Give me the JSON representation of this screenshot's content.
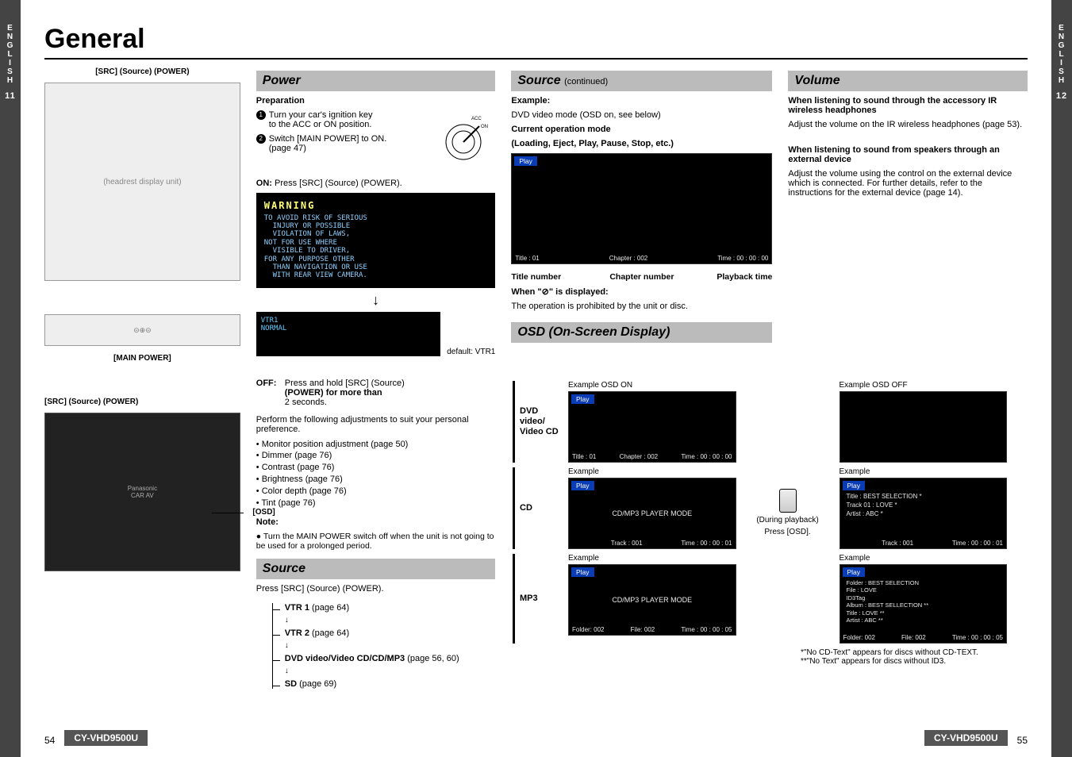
{
  "left_tab": {
    "lang": "E\nN\nG\nL\nI\nS\nH",
    "num": "11"
  },
  "right_tab": {
    "lang": "E\nN\nG\nL\nI\nS\nH",
    "num": "12"
  },
  "title": "General",
  "col1": {
    "src_label": "[SRC] (Source) (POWER)",
    "main_power_label": "[MAIN POWER]",
    "src_label2": "[SRC] (Source) (POWER)",
    "osd_label": "[OSD]",
    "device_placeholder": "(headrest display unit)",
    "remote_placeholder": "Panasonic\nCAR AV"
  },
  "power": {
    "header": "Power",
    "prep_head": "Preparation",
    "step1_a": "Turn your car's ignition key",
    "step1_b": "to the ACC or ON position.",
    "step2_a": "Switch [MAIN POWER] to ON.",
    "step2_b": "(page 47)",
    "on_line_a": "ON:",
    "on_line_b": "Press [SRC] (Source) (POWER).",
    "warn_title": "WARNING",
    "warn_body": "TO AVOID RISK OF SERIOUS\n  INJURY OR POSSIBLE\n  VIOLATION OF LAWS,\nNOT FOR USE WHERE\n  VISIBLE TO DRIVER,\nFOR ANY PURPOSE OTHER\n  THAN NAVIGATION OR USE\n  WITH REAR VIEW CAMERA.",
    "vtr_box": "VTR1\nNORMAL",
    "default_label": "default: VTR1",
    "off_term": "OFF:",
    "off_a": "Press and hold [SRC] (Source)",
    "off_b": "(POWER) for more than",
    "off_c": "2 seconds.",
    "adjust_intro": "Perform the following adjustments to suit your personal preference.",
    "bullets": [
      "Monitor position adjustment (page 50)",
      "Dimmer (page 76)",
      "Contrast (page 76)",
      "Brightness (page 76)",
      "Color depth (page 76)",
      "Tint (page 76)"
    ],
    "note_head": "Note:",
    "note_body": "Turn the MAIN POWER switch off when the unit is not going to be used for a prolonged period."
  },
  "source": {
    "header": "Source",
    "press_line": "Press [SRC] (Source) (POWER).",
    "items": [
      {
        "name": "VTR 1",
        "pg": "(page 64)"
      },
      {
        "name": "VTR 2",
        "pg": "(page 64)"
      },
      {
        "name": "DVD video/Video CD/CD/MP3",
        "pg": "(page 56, 60)"
      },
      {
        "name": "SD",
        "pg": "(page 69)"
      }
    ]
  },
  "source_cont": {
    "header": "Source",
    "header_small": "(continued)",
    "example_head": "Example:",
    "example_line": "DVD video mode (OSD on, see below)",
    "cur_head": "Current operation mode",
    "cur_sub": "(Loading, Eject, Play, Pause, Stop, etc.)",
    "screen_top": "Play",
    "screen_bot_l": "Title : 01",
    "screen_bot_m": "Chapter : 002",
    "screen_bot_r": "Time : 00 : 00 : 00",
    "sub_labels": {
      "a": "Title number",
      "b": "Chapter number",
      "c": "Playback time"
    },
    "when_a": "When \"",
    "when_sym": "⊘",
    "when_b": "\" is displayed:",
    "when_body": "The operation is prohibited by the unit or disc."
  },
  "volume": {
    "header": "Volume",
    "h1": "When listening to sound through the accessory IR wireless headphones",
    "p1": "Adjust the volume on the IR wireless headphones (page 53).",
    "h2": "When listening to sound from speakers through an external device",
    "p2": "Adjust the volume using the control on the external device which is connected. For further details, refer to the instructions for the external device (page 14)."
  },
  "osd": {
    "header": "OSD (On-Screen Display)",
    "labels": {
      "dvd": "DVD video/ Video CD",
      "cd": "CD",
      "mp3": "MP3"
    },
    "middle": {
      "during": "(During playback)",
      "press": "Press [OSD]."
    },
    "on_ex": "Example     OSD ON",
    "off_ex": "Example     OSD OFF",
    "ex_word": "Example",
    "dvd_on": {
      "top": "Play",
      "bl": "Title : 01",
      "bm": "Chapter : 002",
      "br": "Time : 00 : 00 : 00"
    },
    "cd_on": {
      "top": "Play",
      "center": "CD/MP3 PLAYER MODE",
      "bl": "",
      "bm": "Track : 001",
      "br": "Time : 00 : 00 : 01"
    },
    "cd_off": {
      "top": "Play",
      "l1": "Title       : BEST SELECTION *",
      "l2": "Track 01 : LOVE *",
      "l3": "Artist     : ABC *",
      "bm": "Track : 001",
      "br": "Time : 00 : 00 : 01"
    },
    "mp3_on": {
      "top": "Play",
      "center": "CD/MP3 PLAYER MODE",
      "bl": "Folder: 002",
      "bm": "File: 002",
      "br": "Time : 00 : 00 : 05"
    },
    "mp3_off": {
      "top": "Play",
      "l1": "Folder    : BEST SELECTION",
      "l2": "File        : LOVE",
      "l3": "ID3Tag",
      "l4": " Album   : BEST SELLECTION **",
      "l5": " Title      : LOVE **",
      "l6": " Artist     : ABC **",
      "bl": "Folder: 002",
      "bm": "File: 002",
      "br": "Time : 00 : 00 : 05"
    },
    "foot1": "*\"No CD-Text\" appears for discs without CD-TEXT.",
    "foot2": "**\"No Text\" appears for discs without ID3."
  },
  "footer": {
    "page_left": "54",
    "page_right": "55",
    "model": "CY-VHD9500U"
  }
}
